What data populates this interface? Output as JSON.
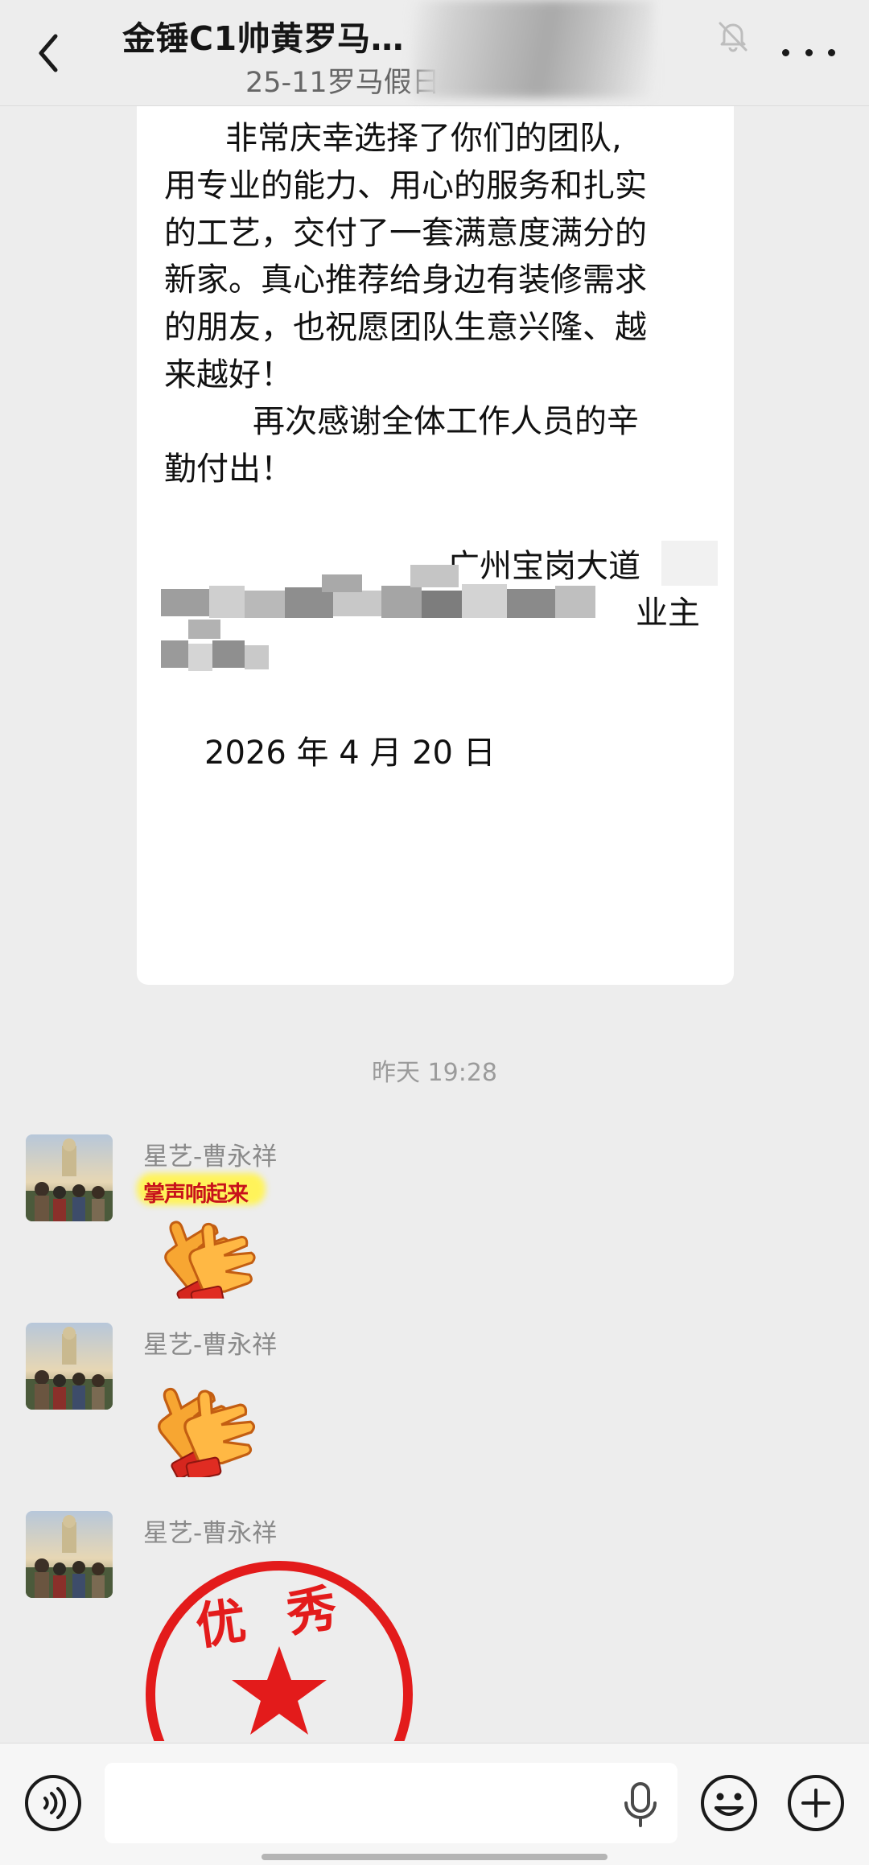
{
  "header": {
    "title": "金锤C1帅黄罗马…",
    "subtitle": "25-11罗马假日"
  },
  "letter": {
    "lines": [
      "非常庆幸选择了你们的团队,",
      "用专业的能力、用心的服务和扎实",
      "的工艺，交付了一套满意度满分的",
      "新家。真心推荐给身边有装修需求",
      "的朋友，也祝愿团队生意兴隆、越",
      "来越好！",
      "再次感谢全体工作人员的辛",
      "勤付出！"
    ],
    "signature_place": "广州宝岗大道",
    "signature_role": "业主",
    "date": "2026 年 4 月 20 日"
  },
  "timestamp": "昨天 19:28",
  "messages": [
    {
      "sender": "星艺-曹永祥",
      "sticker": "applause-sticker-with-caption",
      "sticker_caption": "掌声响起来"
    },
    {
      "sender": "星艺-曹永祥",
      "sticker": "applause-sticker"
    },
    {
      "sender": "星艺-曹永祥",
      "sticker": "excellent-stamp-sticker",
      "stamp_text": "优秀"
    }
  ],
  "input": {
    "value": "",
    "placeholder": ""
  },
  "colors": {
    "background": "#ededed",
    "bubble": "#ffffff",
    "stamp_red": "#e31b1b",
    "hand_orange": "#f5a425"
  },
  "icons": [
    "back-icon",
    "mute-bell-icon",
    "more-icon",
    "voice-icon",
    "microphone-icon",
    "emoji-icon",
    "plus-icon"
  ]
}
